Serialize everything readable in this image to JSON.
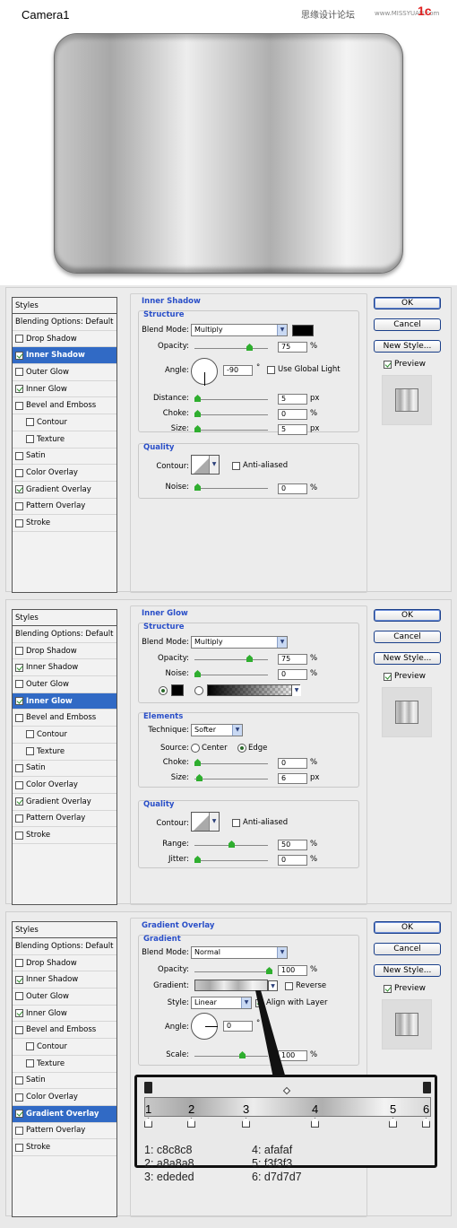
{
  "title": "Camera1",
  "watermark": {
    "cn": "思缘设计论坛",
    "url": "www.MISSYUAN.com",
    "mark": "1c"
  },
  "panels": [
    {
      "sidebar": {
        "header": "Styles",
        "items": [
          {
            "label": "Blending Options: Default",
            "checkbox": false,
            "checked": false,
            "sub": false,
            "active": false
          },
          {
            "label": "Drop Shadow",
            "checkbox": true,
            "checked": false,
            "sub": false,
            "active": false
          },
          {
            "label": "Inner Shadow",
            "checkbox": true,
            "checked": true,
            "sub": false,
            "active": true
          },
          {
            "label": "Outer Glow",
            "checkbox": true,
            "checked": false,
            "sub": false,
            "active": false
          },
          {
            "label": "Inner Glow",
            "checkbox": true,
            "checked": true,
            "sub": false,
            "active": false
          },
          {
            "label": "Bevel and Emboss",
            "checkbox": true,
            "checked": false,
            "sub": false,
            "active": false
          },
          {
            "label": "Contour",
            "checkbox": true,
            "checked": false,
            "sub": true,
            "active": false
          },
          {
            "label": "Texture",
            "checkbox": true,
            "checked": false,
            "sub": true,
            "active": false
          },
          {
            "label": "Satin",
            "checkbox": true,
            "checked": false,
            "sub": false,
            "active": false
          },
          {
            "label": "Color Overlay",
            "checkbox": true,
            "checked": false,
            "sub": false,
            "active": false
          },
          {
            "label": "Gradient Overlay",
            "checkbox": true,
            "checked": true,
            "sub": false,
            "active": false
          },
          {
            "label": "Pattern Overlay",
            "checkbox": true,
            "checked": false,
            "sub": false,
            "active": false
          },
          {
            "label": "Stroke",
            "checkbox": true,
            "checked": false,
            "sub": false,
            "active": false
          }
        ]
      },
      "section": "Inner Shadow",
      "structure": "Structure",
      "blend_label": "Blend Mode:",
      "blend": "Multiply",
      "opacity_label": "Opacity:",
      "opacity": "75",
      "opacity_level": 0.75,
      "angle_label": "Angle:",
      "angle": "-90",
      "global_light": "Use Global Light",
      "distance_label": "Distance:",
      "distance": "5",
      "choke_label": "Choke:",
      "choke": "0",
      "size_label": "Size:",
      "size": "5",
      "quality": "Quality",
      "contour_label": "Contour:",
      "anti_aliased": "Anti-aliased",
      "noise_label": "Noise:",
      "noise": "0"
    },
    {
      "section": "Inner Glow",
      "structure": "Structure",
      "blend_label": "Blend Mode:",
      "blend": "Multiply",
      "opacity_label": "Opacity:",
      "opacity": "75",
      "noise_label": "Noise:",
      "noise": "0",
      "elements": "Elements",
      "technique_label": "Technique:",
      "technique": "Softer",
      "source_label": "Source:",
      "center": "Center",
      "edge": "Edge",
      "choke_label": "Choke:",
      "choke": "0",
      "size_label": "Size:",
      "size": "6",
      "quality": "Quality",
      "contour_label": "Contour:",
      "anti_aliased": "Anti-aliased",
      "range_label": "Range:",
      "range": "50",
      "jitter_label": "Jitter:",
      "jitter": "0"
    },
    {
      "section": "Gradient Overlay",
      "gradient_title": "Gradient",
      "blend_label": "Blend Mode:",
      "blend": "Normal",
      "opacity_label": "Opacity:",
      "opacity": "100",
      "gradient_label": "Gradient:",
      "reverse": "Reverse",
      "style_label": "Style:",
      "style": "Linear",
      "align": "Align with Layer",
      "angle_label": "Angle:",
      "angle": "0",
      "scale_label": "Scale:",
      "scale": "100"
    }
  ],
  "buttons": {
    "ok": "OK",
    "cancel": "Cancel",
    "new_style": "New Style...",
    "preview": "Preview"
  },
  "percent": "%",
  "px": "px",
  "degree": "°",
  "gradient_stops": {
    "numbers": [
      "1",
      "2",
      "3",
      "4",
      "5",
      "6"
    ],
    "codes_left": [
      "1: c8c8c8",
      "2: a8a8a8",
      "3: ededed"
    ],
    "codes_right": [
      "4: afafaf",
      "5: f3f3f3",
      "6: d7d7d7"
    ],
    "colors": [
      "#c8c8c8",
      "#a8a8a8",
      "#ededed",
      "#afafaf",
      "#f3f3f3",
      "#d7d7d7"
    ]
  }
}
